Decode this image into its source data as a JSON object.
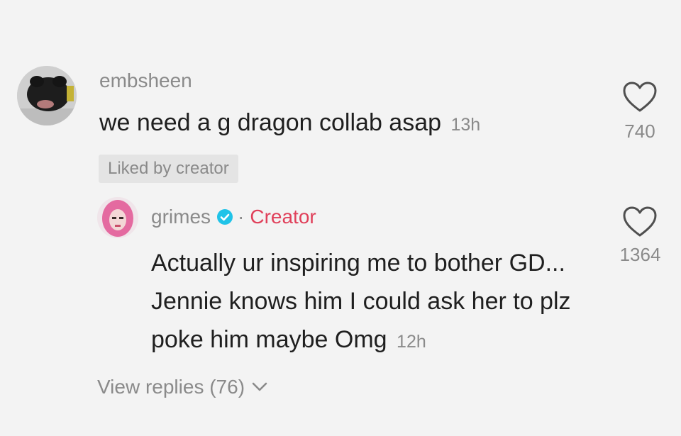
{
  "comment": {
    "username": "embsheen",
    "text": "we need a g dragon collab asap",
    "timestamp": "13h",
    "liked_badge": "Liked by creator",
    "like_icon": "heart-outline-icon",
    "likes": "740"
  },
  "reply": {
    "username": "grimes",
    "verified_icon": "verified-check-icon",
    "separator": "·",
    "creator_label": "Creator",
    "text": "Actually ur inspiring me to bother GD... Jennie knows him I could ask her to plz poke him maybe Omg",
    "timestamp": "12h",
    "like_icon": "heart-outline-icon",
    "likes": "1364"
  },
  "view_replies": {
    "label": "View replies (76)",
    "icon": "chevron-down-icon"
  },
  "colors": {
    "background": "#f3f3f3",
    "primary_text": "#1f1f1f",
    "secondary_text": "#8a8a8a",
    "creator_accent": "#e0405a",
    "verified_blue": "#20c3e8",
    "badge_bg": "#e4e4e4"
  }
}
